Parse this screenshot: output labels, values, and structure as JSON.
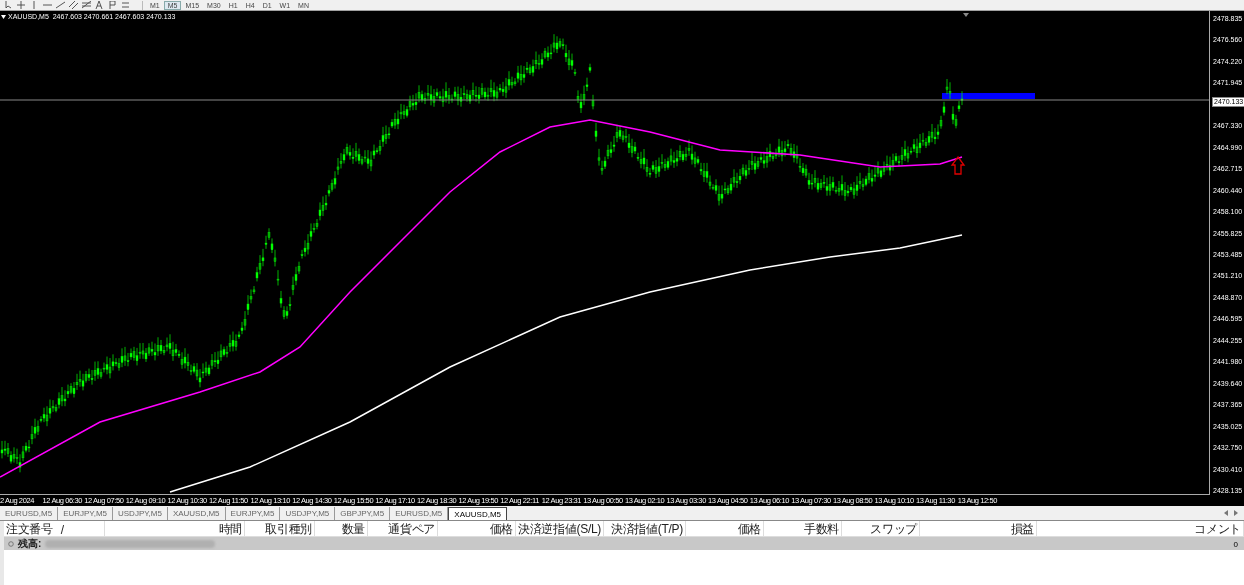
{
  "toolbar": {
    "timeframes": [
      {
        "label": "M1",
        "selected": false
      },
      {
        "label": "M5",
        "selected": true
      },
      {
        "label": "M15",
        "selected": false
      },
      {
        "label": "M30",
        "selected": false
      },
      {
        "label": "H1",
        "selected": false
      },
      {
        "label": "H4",
        "selected": false
      },
      {
        "label": "D1",
        "selected": false
      },
      {
        "label": "W1",
        "selected": false
      },
      {
        "label": "MN",
        "selected": false
      }
    ]
  },
  "chart": {
    "header": "XAUUSD,M5  2467.603 2470.661 2467.603 2470.133",
    "current_price": "2470.133",
    "price_axis": [
      "2478.835",
      "2476.560",
      "2474.220",
      "2471.945",
      "2467.330",
      "2464.990",
      "2462.715",
      "2460.440",
      "2458.100",
      "2455.825",
      "2453.485",
      "2451.210",
      "2448.870",
      "2446.595",
      "2444.255",
      "2441.980",
      "2439.640",
      "2437.365",
      "2435.025",
      "2432.750",
      "2430.410",
      "2428.135"
    ],
    "time_axis": [
      "2 Aug 2024",
      "12 Aug 06:30",
      "12 Aug 07:50",
      "12 Aug 09:10",
      "12 Aug 10:30",
      "12 Aug 11:50",
      "12 Aug 13:10",
      "12 Aug 14:30",
      "12 Aug 15:50",
      "12 Aug 17:10",
      "12 Aug 18:30",
      "12 Aug 19:50",
      "12 Aug 22:11",
      "12 Aug 23:31",
      "13 Aug 00:50",
      "13 Aug 02:10",
      "13 Aug 03:30",
      "13 Aug 04:50",
      "13 Aug 06:10",
      "13 Aug 07:30",
      "13 Aug 08:50",
      "13 Aug 10:10",
      "13 Aug 11:30",
      "13 Aug 12:50"
    ]
  },
  "tabs": [
    {
      "label": "EURUSD,M5",
      "selected": false
    },
    {
      "label": "EURJPY,M5",
      "selected": false
    },
    {
      "label": "USDJPY,M5",
      "selected": false
    },
    {
      "label": "XAUUSD,M5",
      "selected": false
    },
    {
      "label": "EURJPY,M5",
      "selected": false
    },
    {
      "label": "USDJPY,M5",
      "selected": false
    },
    {
      "label": "GBPJPY,M5",
      "selected": false
    },
    {
      "label": "EURUSD,M5",
      "selected": false
    },
    {
      "label": "XAUUSD,M5",
      "selected": true
    }
  ],
  "table": {
    "columns": [
      {
        "label": "注文番号",
        "sort_mark": "/"
      },
      {
        "label": "時間"
      },
      {
        "label": "取引種別"
      },
      {
        "label": "数量"
      },
      {
        "label": "通貨ペア"
      },
      {
        "label": "価格"
      },
      {
        "label": "決済逆指値(S/L)"
      },
      {
        "label": "決済指値(T/P)"
      },
      {
        "label": "価格"
      },
      {
        "label": "手数料"
      },
      {
        "label": "スワップ"
      },
      {
        "label": "損益"
      },
      {
        "label": "コメント"
      }
    ],
    "balance_row": {
      "label": "残高:",
      "profit": "0"
    }
  }
}
